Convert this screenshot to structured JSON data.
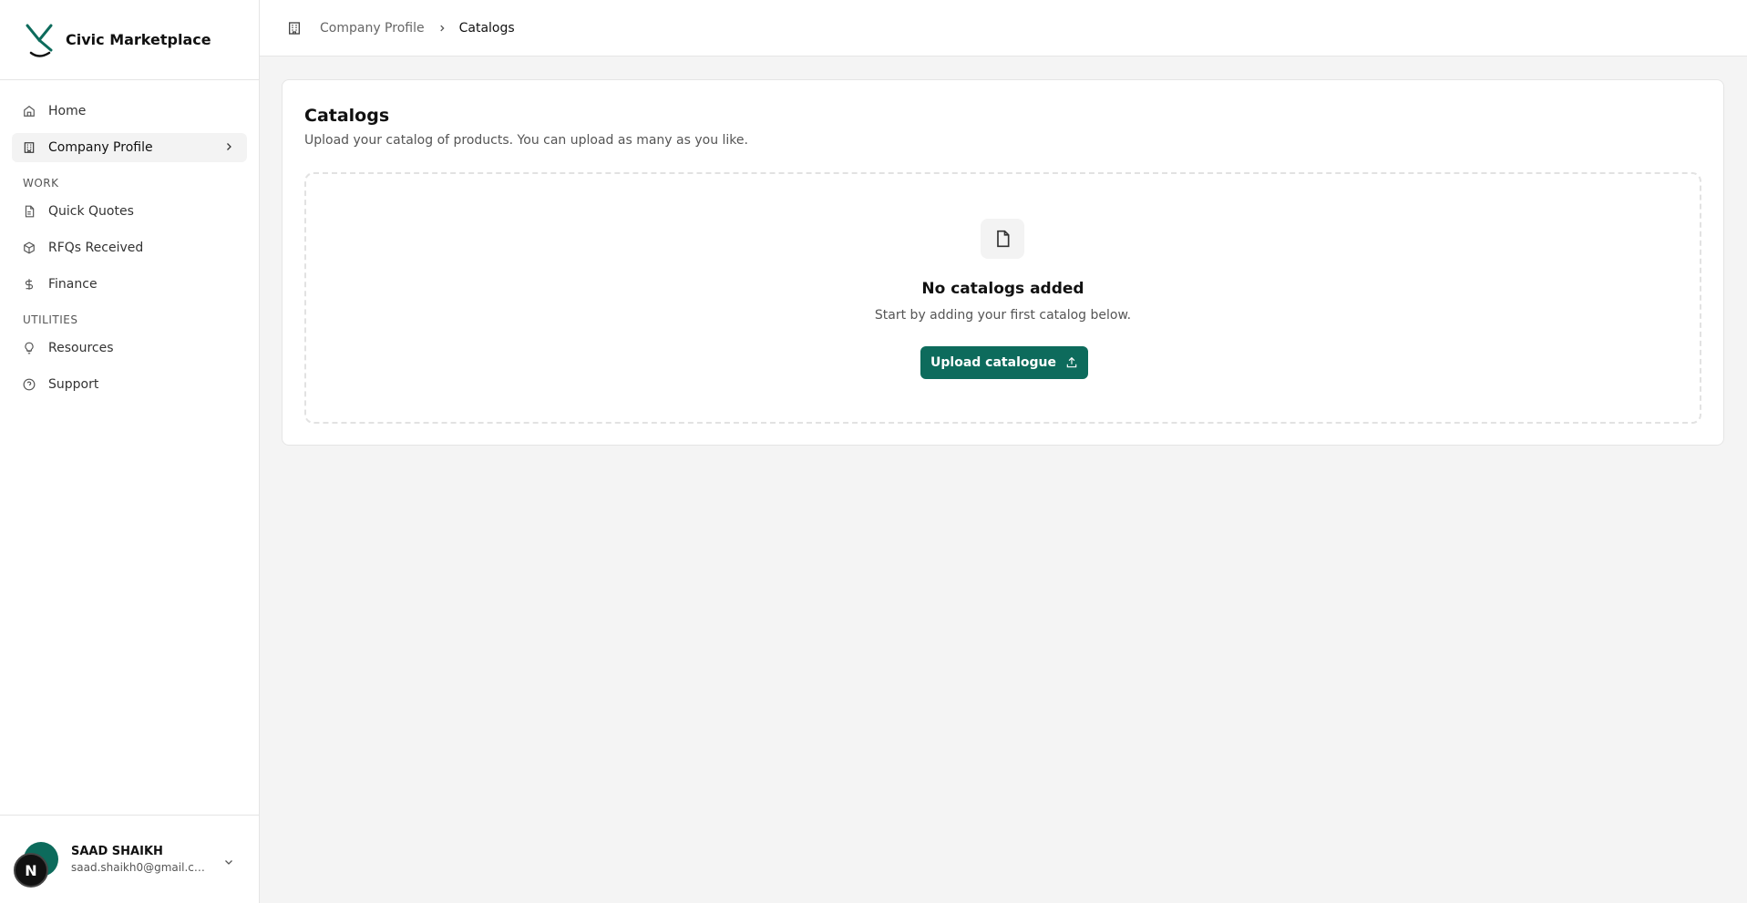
{
  "brand": {
    "name": "Civic Marketplace"
  },
  "sidebar": {
    "items": [
      {
        "label": "Home",
        "icon": "home-icon"
      },
      {
        "label": "Company Profile",
        "icon": "building-icon",
        "active": true
      }
    ],
    "sections": [
      {
        "label": "WORK",
        "items": [
          {
            "label": "Quick Quotes",
            "icon": "file-text-icon"
          },
          {
            "label": "RFQs Received",
            "icon": "package-icon"
          },
          {
            "label": "Finance",
            "icon": "dollar-icon"
          }
        ]
      },
      {
        "label": "UTILITIES",
        "items": [
          {
            "label": "Resources",
            "icon": "lightbulb-icon"
          },
          {
            "label": "Support",
            "icon": "help-circle-icon"
          }
        ]
      }
    ]
  },
  "user": {
    "name": "SAAD SHAIKH",
    "email": "saad.shaikh0@gmail.com",
    "dev_badge": "N"
  },
  "breadcrumb": {
    "parent": "Company Profile",
    "current": "Catalogs"
  },
  "main": {
    "title": "Catalogs",
    "subtitle": "Upload your catalog of products. You can upload as many as you like.",
    "empty_title": "No catalogs added",
    "empty_subtitle": "Start by adding your first catalog below.",
    "upload_label": "Upload catalogue"
  },
  "colors": {
    "accent": "#0d6b5c",
    "background": "#f4f4f4"
  }
}
